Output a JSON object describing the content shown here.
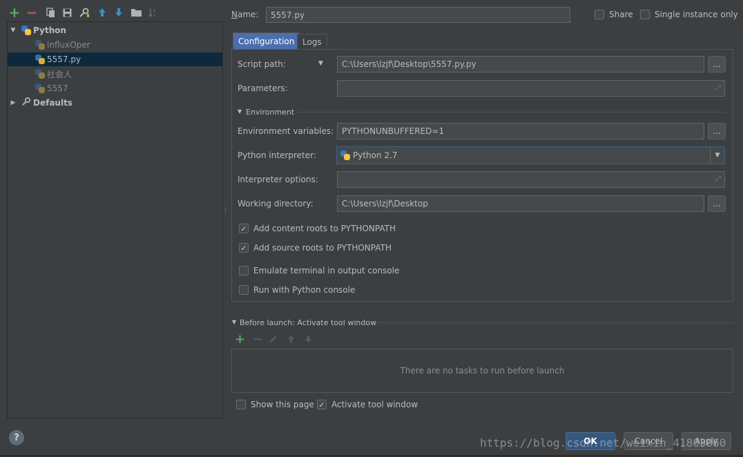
{
  "toolbar": {
    "icons": [
      "add-icon",
      "remove-icon",
      "copy-icon",
      "save-icon",
      "edit-defaults-icon",
      "move-up-icon",
      "move-down-icon",
      "folder-icon",
      "sort-icon"
    ]
  },
  "tree": {
    "groups": [
      {
        "label": "Python",
        "expanded": true,
        "items": [
          {
            "label": "influxOper"
          },
          {
            "label": "5557.py",
            "selected": true
          },
          {
            "label": "社会人"
          },
          {
            "label": "5557"
          }
        ]
      },
      {
        "label": "Defaults",
        "expanded": false
      }
    ]
  },
  "header": {
    "name_label": "Name:",
    "name_value": "5557.py",
    "share_label": "Share",
    "single_instance_label": "Single instance only"
  },
  "tabs": [
    "Configuration",
    "Logs"
  ],
  "config": {
    "script_path_label": "Script path:",
    "script_path_value": "C:\\Users\\lzjf\\Desktop\\5557.py.py",
    "parameters_label": "Parameters:",
    "parameters_value": "",
    "environment_section": "Environment",
    "env_vars_label": "Environment variables:",
    "env_vars_value": "PYTHONUNBUFFERED=1",
    "interpreter_label": "Python interpreter:",
    "interpreter_value": "Python 2.7",
    "interp_options_label": "Interpreter options:",
    "interp_options_value": "",
    "working_dir_label": "Working directory:",
    "working_dir_value": "C:\\Users\\lzjf\\Desktop",
    "browse_label": "...",
    "checks": [
      {
        "label": "Add content roots to PYTHONPATH",
        "checked": true
      },
      {
        "label": "Add source roots to PYTHONPATH",
        "checked": true
      },
      {
        "label": "Emulate terminal in output console",
        "checked": false
      },
      {
        "label": "Run with Python console",
        "checked": false
      }
    ]
  },
  "before_launch": {
    "title": "Before launch: Activate tool window",
    "empty_text": "There are no tasks to run before launch",
    "show_page_label": "Show this page",
    "show_page_checked": false,
    "activate_label": "Activate tool window",
    "activate_checked": true
  },
  "buttons": {
    "ok": "OK",
    "cancel": "Cancel",
    "apply": "Apply",
    "help": "?"
  },
  "watermark": "https://blog.csdn.net/weixin_41803060",
  "colors": {
    "background": "#3c3f41",
    "selection": "#0d293e",
    "accent": "#4b6eaf",
    "add_green": "#59a869",
    "remove_red": "#c75450"
  }
}
